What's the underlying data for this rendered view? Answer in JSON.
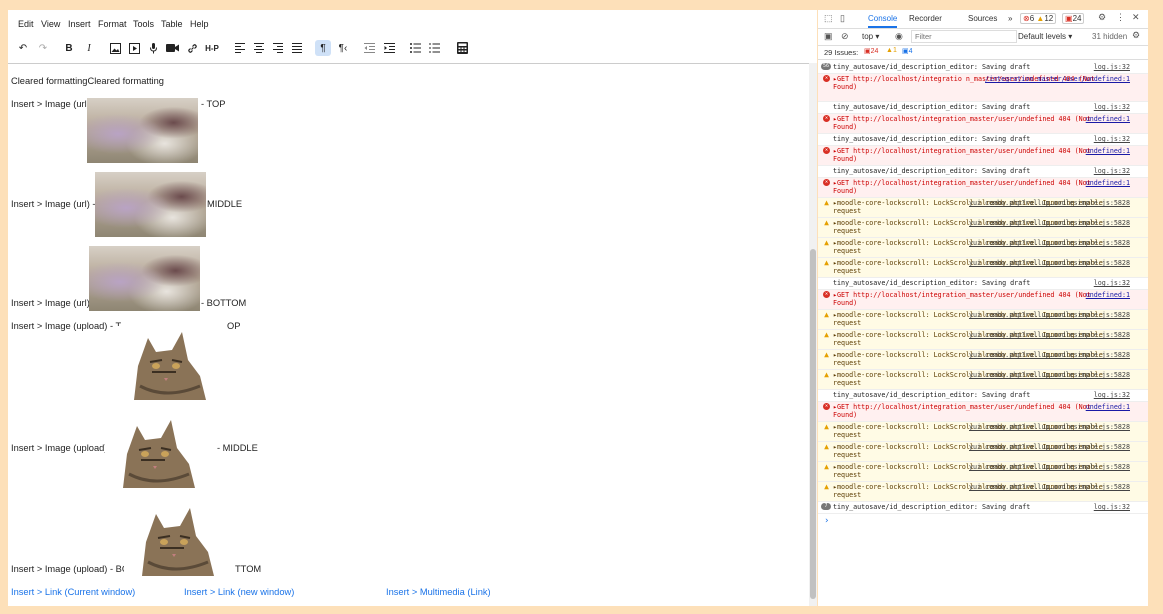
{
  "editor": {
    "menu": [
      "Edit",
      "View",
      "Insert",
      "Format",
      "Tools",
      "Table",
      "Help"
    ],
    "toolbar": {
      "undo": "undo-icon",
      "redo": "redo-icon",
      "bold": "B",
      "italic": "I",
      "image": "image-icon",
      "media": "media-icon",
      "mic": "mic-icon",
      "video": "video-icon",
      "link": "link-icon",
      "h5p": "H-P",
      "align_left": "align-left-icon",
      "align_center": "align-center-icon",
      "align_right": "align-right-icon",
      "justify": "justify-icon",
      "ltr": "¶",
      "rtl": "¶‹",
      "outdent": "outdent-icon",
      "indent": "indent-icon",
      "bullist": "bullet-list-icon",
      "numlist": "numbered-list-icon",
      "calc": "calculator-icon"
    },
    "content": {
      "cleared": "Cleared formattingCleared formatting",
      "img_url_top_a": "Insert > Image (url)",
      "img_url_top_b": "- TOP",
      "img_url_mid_a": "Insert > Image (url) -",
      "img_url_mid_b": "MIDDLE",
      "img_url_bot_a": "Insert > Image (url)",
      "img_url_bot_b": "- BOTTOM",
      "img_up_top_a": "Insert > Image (upload) - T",
      "img_up_top_b": "OP",
      "img_up_mid_a": "Insert > Image (upload)",
      "img_up_mid_b": "- MIDDLE",
      "img_up_bot_a": "Insert > Image (upload) - BO",
      "img_up_bot_b": "TTOM",
      "link_current": "Insert > Link (Current window)",
      "link_new": "Insert > Link (new window)",
      "link_media": "Insert > Multimedia (Link)"
    }
  },
  "devtools": {
    "tabs": {
      "console": "Console",
      "recorder": "Recorder",
      "sources": "Sources",
      "more": "»"
    },
    "counts": {
      "errors": "6",
      "warnings": "12",
      "issues": "24"
    },
    "filter": {
      "context": "top ▾",
      "placeholder": "Filter",
      "levels": "Default levels ▾",
      "hidden": "31 hidden"
    },
    "issues_bar": {
      "label": "29 Issues:",
      "errors": "24",
      "warnings": "1",
      "info": "4"
    },
    "log": [
      {
        "type": "info",
        "count": "56",
        "msg": "tiny_autosave/id_description_editor: Saving draft",
        "src": "log.js:32"
      },
      {
        "type": "err",
        "msg": "▸GET http://localhost/integratio n_master/user/undefined 404 (Not Found)",
        "src": "/integration_master/user/undefined:1"
      },
      {
        "type": "info",
        "msg": "tiny_autosave/id_description_editor: Saving draft",
        "src": "log.js:32"
      },
      {
        "type": "err",
        "msg": "▸GET http://localhost/integration_master/user/undefined 404 (Not Found)",
        "src": "undefined:1"
      },
      {
        "type": "info",
        "msg": "tiny_autosave/id_description_editor: Saving draft",
        "src": "log.js:32"
      },
      {
        "type": "err",
        "msg": "▸GET http://localhost/integration_master/user/undefined 404 (Not Found)",
        "src": "undefined:1"
      },
      {
        "type": "info",
        "msg": "tiny_autosave/id_description_editor: Saving draft",
        "src": "log.js:32"
      },
      {
        "type": "err",
        "msg": "▸GET http://localhost/integration_master/user/undefined 404 (Not Found)",
        "src": "undefined:1"
      },
      {
        "type": "warn",
        "msg": "▸moodle-core-lockscroll: LockScroll already active. Ignoring enable request",
        "src": "yui_combo.php?rollup…oodlesimple.js:5828"
      },
      {
        "type": "warn",
        "msg": "▸moodle-core-lockscroll: LockScroll already active. Ignoring enable request",
        "src": "yui_combo.php?rollup…oodlesimple.js:5828"
      },
      {
        "type": "warn",
        "msg": "▸moodle-core-lockscroll: LockScroll already active. Ignoring enable request",
        "src": "yui_combo.php?rollup…oodlesimple.js:5828"
      },
      {
        "type": "warn",
        "msg": "▸moodle-core-lockscroll: LockScroll already active. Ignoring enable request",
        "src": "yui_combo.php?rollup…oodlesimple.js:5828"
      },
      {
        "type": "info",
        "msg": "tiny_autosave/id_description_editor: Saving draft",
        "src": "log.js:32"
      },
      {
        "type": "err",
        "msg": "▸GET http://localhost/integration_master/user/undefined 404 (Not Found)",
        "src": "undefined:1"
      },
      {
        "type": "warn",
        "msg": "▸moodle-core-lockscroll: LockScroll already active. Ignoring enable request",
        "src": "yui_combo.php?rollup…oodlesimple.js:5828"
      },
      {
        "type": "warn",
        "msg": "▸moodle-core-lockscroll: LockScroll already active. Ignoring enable request",
        "src": "yui_combo.php?rollup…oodlesimple.js:5828"
      },
      {
        "type": "warn",
        "msg": "▸moodle-core-lockscroll: LockScroll already active. Ignoring enable request",
        "src": "yui_combo.php?rollup…oodlesimple.js:5828"
      },
      {
        "type": "warn",
        "msg": "▸moodle-core-lockscroll: LockScroll already active. Ignoring enable request",
        "src": "yui_combo.php?rollup…oodlesimple.js:5828"
      },
      {
        "type": "info",
        "msg": "tiny_autosave/id_description_editor: Saving draft",
        "src": "log.js:32"
      },
      {
        "type": "err",
        "msg": "▸GET http://localhost/integration_master/user/undefined 404 (Not Found)",
        "src": "undefined:1"
      },
      {
        "type": "warn",
        "msg": "▸moodle-core-lockscroll: LockScroll already active. Ignoring enable request",
        "src": "yui_combo.php?rollup…oodlesimple.js:5828"
      },
      {
        "type": "warn",
        "msg": "▸moodle-core-lockscroll: LockScroll already active. Ignoring enable request",
        "src": "yui_combo.php?rollup…oodlesimple.js:5828"
      },
      {
        "type": "warn",
        "msg": "▸moodle-core-lockscroll: LockScroll already active. Ignoring enable request",
        "src": "yui_combo.php?rollup…oodlesimple.js:5828"
      },
      {
        "type": "warn",
        "msg": "▸moodle-core-lockscroll: LockScroll already active. Ignoring enable request",
        "src": "yui_combo.php?rollup…oodlesimple.js:5828"
      },
      {
        "type": "info",
        "count": "7",
        "msg": "tiny_autosave/id_description_editor: Saving draft",
        "src": "log.js:32"
      }
    ],
    "prompt": "›"
  }
}
